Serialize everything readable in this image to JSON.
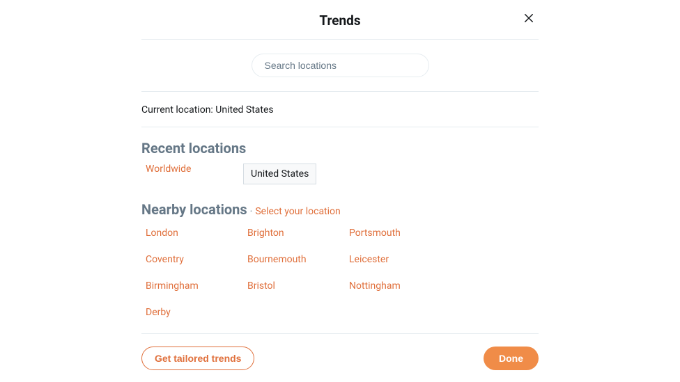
{
  "header": {
    "title": "Trends"
  },
  "search": {
    "placeholder": "Search locations",
    "value": ""
  },
  "current_location": {
    "label": "Current location: ",
    "value": "United States"
  },
  "recent": {
    "heading": "Recent locations",
    "items": [
      {
        "label": "Worldwide",
        "selected": false
      },
      {
        "label": "United States",
        "selected": true
      }
    ]
  },
  "nearby": {
    "heading": "Nearby locations",
    "separator": "·",
    "select_label": "Select your location",
    "items": [
      "London",
      "Brighton",
      "Portsmouth",
      "Coventry",
      "Bournemouth",
      "Leicester",
      "Birmingham",
      "Bristol",
      "Nottingham",
      "Derby"
    ]
  },
  "footer": {
    "tailored_label": "Get tailored trends",
    "done_label": "Done"
  }
}
